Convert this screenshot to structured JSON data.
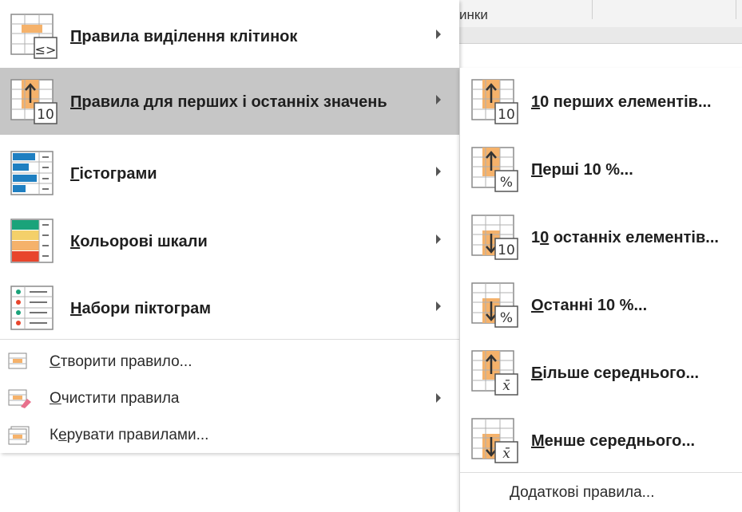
{
  "background": {
    "header_text": "инки"
  },
  "menu": {
    "items": [
      {
        "name": "highlight-cells-rules",
        "icon": "highlight-cells-icon",
        "hotkey": "П",
        "rest": "равила виділення клітинок",
        "has_submenu": true
      },
      {
        "name": "top-bottom-rules",
        "icon": "top-bottom-icon",
        "hotkey": "П",
        "rest": "равила для перших і останніх значень",
        "has_submenu": true,
        "hovered": true
      },
      {
        "name": "data-bars",
        "icon": "data-bars-icon",
        "hotkey": "Г",
        "rest": "істограми",
        "has_submenu": true
      },
      {
        "name": "color-scales",
        "icon": "color-scales-icon",
        "hotkey": "К",
        "rest": "ольорові шкали",
        "has_submenu": true
      },
      {
        "name": "icon-sets",
        "icon": "icon-sets-icon",
        "hotkey": "Н",
        "rest": "абори піктограм",
        "has_submenu": true
      }
    ],
    "actions": [
      {
        "name": "new-rule",
        "icon": "new-rule-icon",
        "hotkey": "С",
        "rest": "творити правило...",
        "has_submenu": false
      },
      {
        "name": "clear-rules",
        "icon": "clear-rules-icon",
        "hotkey": "О",
        "rest": "чистити правила",
        "has_submenu": true
      },
      {
        "name": "manage-rules",
        "icon": "manage-rules-icon",
        "pre": "К",
        "hotkey": "е",
        "rest": "рувати правилами...",
        "has_submenu": false
      }
    ]
  },
  "submenu": {
    "items": [
      {
        "name": "top-10-items",
        "icon": "top-10-icon",
        "badge": "10",
        "direction": "up",
        "pre": "",
        "hotkey": "1",
        "rest": "0 перших елементів..."
      },
      {
        "name": "top-10-percent",
        "icon": "top-10-percent-icon",
        "badge": "%",
        "direction": "up",
        "pre": "",
        "hotkey": "П",
        "rest": "ерші 10 %..."
      },
      {
        "name": "bottom-10-items",
        "icon": "bottom-10-icon",
        "badge": "10",
        "direction": "down",
        "pre": "1",
        "hotkey": "0",
        "rest": " останніх елементів..."
      },
      {
        "name": "bottom-10-percent",
        "icon": "bottom-10-percent-icon",
        "badge": "%",
        "direction": "down",
        "pre": "",
        "hotkey": "О",
        "rest": "станні 10 %..."
      },
      {
        "name": "above-average",
        "icon": "above-average-icon",
        "badge": "x̄",
        "direction": "up",
        "pre": "",
        "hotkey": "Б",
        "rest": "ільше середнього..."
      },
      {
        "name": "below-average",
        "icon": "below-average-icon",
        "badge": "x̄",
        "direction": "down",
        "pre": "",
        "hotkey": "М",
        "rest": "енше середнього..."
      }
    ],
    "more": {
      "pre": "",
      "hotkey": "Д",
      "rest": "одаткові правила..."
    }
  },
  "colors": {
    "hover_bg": "#c6c6c6",
    "orange": "#f5b26b",
    "blue": "#1f7fc1",
    "green": "#1aa37a",
    "red": "#e8452c",
    "yellow": "#f4d06a"
  }
}
